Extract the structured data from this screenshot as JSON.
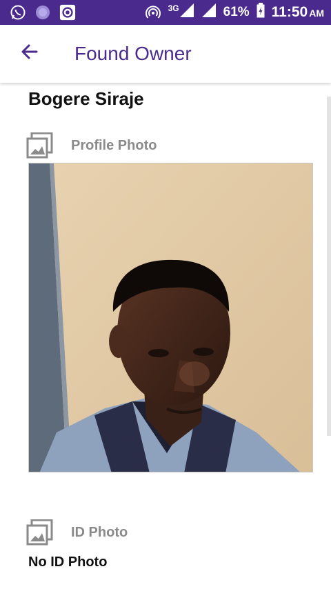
{
  "status_bar": {
    "network": "3G",
    "battery": "61%",
    "time": "11:50",
    "ampm": "AM"
  },
  "app_bar": {
    "title": "Found Owner"
  },
  "owner": {
    "name": "Bogere Siraje"
  },
  "profile_section": {
    "label": "Profile Photo"
  },
  "id_section": {
    "label": "ID Photo",
    "empty_text": "No ID Photo"
  },
  "colors": {
    "primary": "#4a2a8c",
    "label_gray": "#8a8a8a"
  }
}
